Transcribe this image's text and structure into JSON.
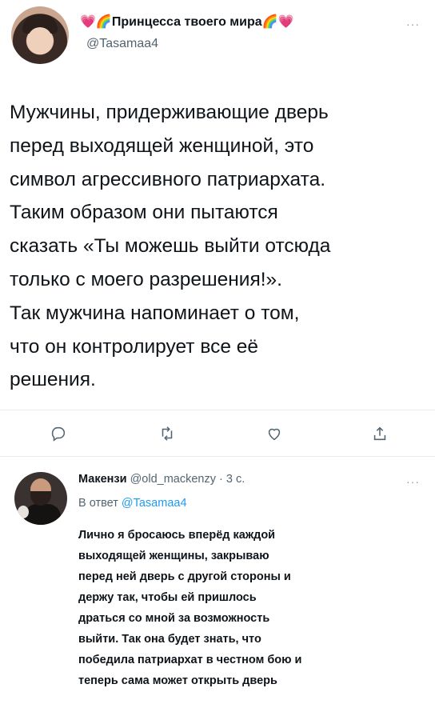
{
  "tweet": {
    "display_name": "💗🌈Принцесса твоего мира🌈💗",
    "handle": "@Tasamaa4",
    "more": "···",
    "lines": [
      "Мужчины, придерживающие дверь",
      "перед выходящей женщиной, это",
      "символ агрессивного патриархата.",
      "Таким образом они пытаются",
      "сказать «Ты можешь выйти отсюда",
      "только с моего разрешения!».",
      "Так мужчина напоминает о том,",
      "что он контролирует все её",
      "решения."
    ],
    "actions": [
      "reply-icon",
      "retweet-icon",
      "like-icon",
      "share-icon"
    ]
  },
  "reply": {
    "display_name": "Макензи",
    "handle": "@old_mackenzy",
    "time": "· 3 с.",
    "more": "···",
    "reply_prefix": "В ответ",
    "reply_to": "@Tasamaa4",
    "lines": [
      "Лично я бросаюсь вперёд каждой",
      "выходящей женщины, закрываю",
      "перед ней дверь с другой стороны и",
      "держу так, чтобы ей пришлось",
      "драться со мной за возможность",
      "выйти. Так она будет знать, что",
      "победила патриархат в честном бою и",
      "теперь сама может открыть дверь"
    ]
  },
  "colors": {
    "text": "#0f1419",
    "secondary": "#536471",
    "accent": "#1d9bf0",
    "divider": "#e6ecf0"
  }
}
